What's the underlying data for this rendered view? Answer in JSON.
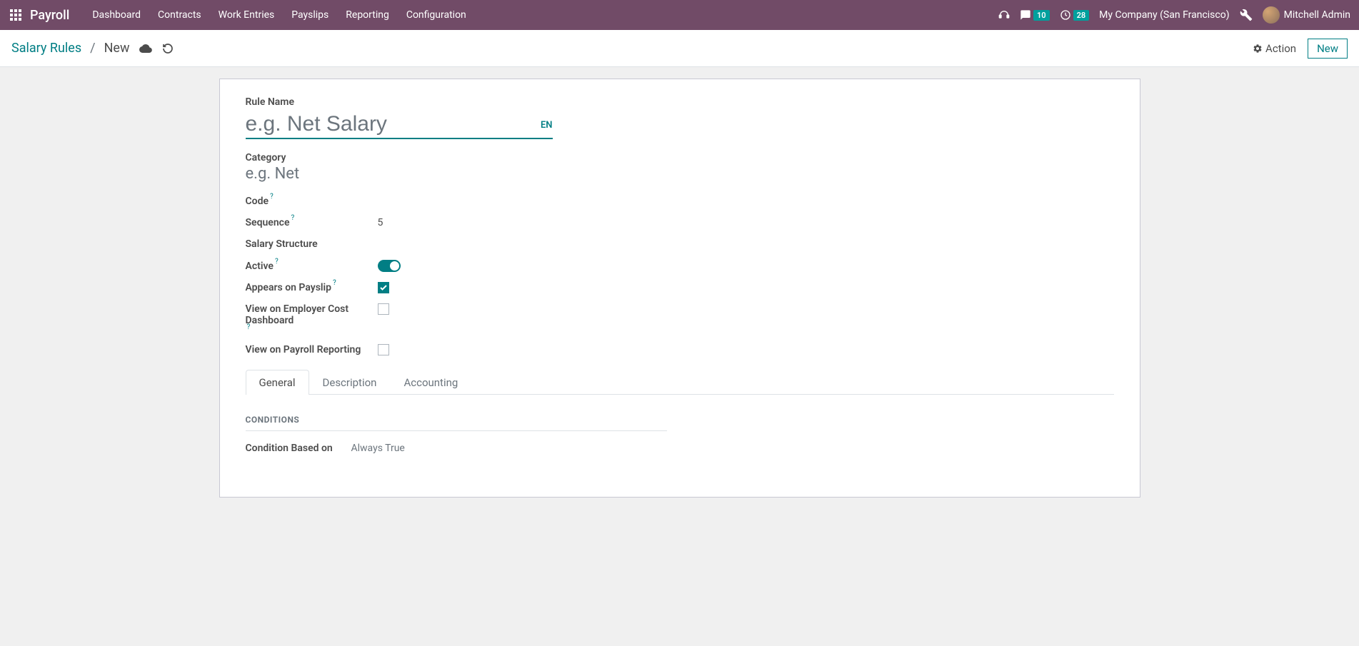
{
  "nav": {
    "app_name": "Payroll",
    "items": [
      "Dashboard",
      "Contracts",
      "Work Entries",
      "Payslips",
      "Reporting",
      "Configuration"
    ],
    "messages_badge": "10",
    "activities_badge": "28",
    "company": "My Company (San Francisco)",
    "user_name": "Mitchell Admin"
  },
  "control": {
    "breadcrumb_root": "Salary Rules",
    "breadcrumb_current": "New",
    "action_label": "Action",
    "new_label": "New"
  },
  "form": {
    "rule_name_label": "Rule Name",
    "rule_name_placeholder": "e.g. Net Salary",
    "lang_tag": "EN",
    "category_label": "Category",
    "category_placeholder": "e.g. Net",
    "code_label": "Code",
    "sequence_label": "Sequence",
    "sequence_value": "5",
    "salary_structure_label": "Salary Structure",
    "active_label": "Active",
    "appears_label": "Appears on Payslip",
    "view_employer_cost_label": "View on Employer Cost Dashboard",
    "view_payroll_reporting_label": "View on Payroll Reporting"
  },
  "tabs": {
    "general": "General",
    "description": "Description",
    "accounting": "Accounting"
  },
  "conditions": {
    "section": "CONDITIONS",
    "based_on_label": "Condition Based on",
    "based_on_value": "Always True"
  }
}
